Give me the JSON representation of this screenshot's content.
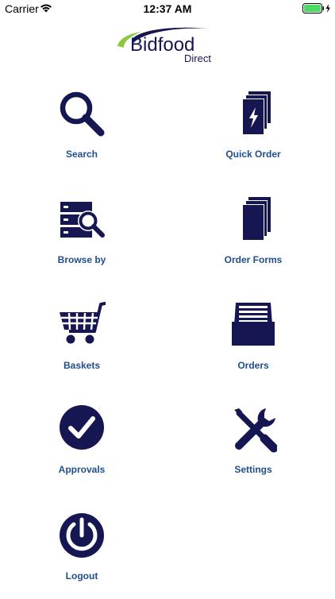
{
  "status_bar": {
    "carrier": "Carrier",
    "time": "12:37 AM"
  },
  "logo": {
    "brand": "Bidfood",
    "sub": "Direct"
  },
  "colors": {
    "icon": "#161652",
    "label": "#1f4e8c",
    "logo_green": "#8dc63f",
    "battery_green": "#4cd964"
  },
  "menu": [
    {
      "label": "Search",
      "icon": "search-icon"
    },
    {
      "label": "Quick Order",
      "icon": "lightning-documents-icon"
    },
    {
      "label": "Browse by",
      "icon": "browse-server-search-icon"
    },
    {
      "label": "Order Forms",
      "icon": "documents-stack-icon"
    },
    {
      "label": "Baskets",
      "icon": "shopping-cart-icon"
    },
    {
      "label": "Orders",
      "icon": "inbox-tray-icon"
    },
    {
      "label": "Approvals",
      "icon": "checkmark-circle-icon"
    },
    {
      "label": "Settings",
      "icon": "tools-icon"
    },
    {
      "label": "Logout",
      "icon": "power-icon"
    }
  ]
}
